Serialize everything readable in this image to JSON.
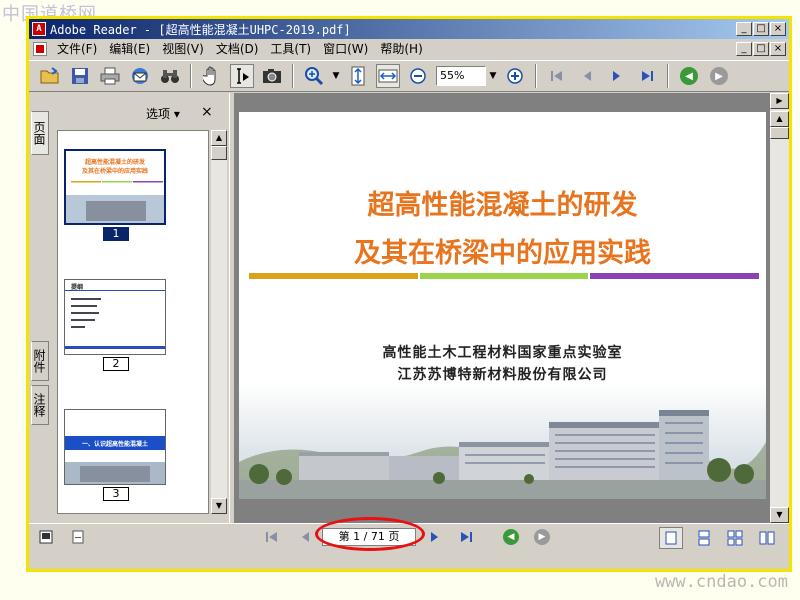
{
  "watermarks": {
    "top_left": "中国道桥网",
    "bottom_right": "www.cndao.com"
  },
  "window": {
    "title": "Adobe Reader - [超高性能混凝土UHPC-2019.pdf]",
    "logo": "adobe-reader-logo",
    "controls": {
      "minimize": "_",
      "maximize": "□",
      "close": "×"
    }
  },
  "menu": {
    "items": [
      {
        "label": "文件(F)",
        "name": "menu-file"
      },
      {
        "label": "编辑(E)",
        "name": "menu-edit"
      },
      {
        "label": "视图(V)",
        "name": "menu-view"
      },
      {
        "label": "文档(D)",
        "name": "menu-document"
      },
      {
        "label": "工具(T)",
        "name": "menu-tools"
      },
      {
        "label": "窗口(W)",
        "name": "menu-window"
      },
      {
        "label": "帮助(H)",
        "name": "menu-help"
      }
    ]
  },
  "toolbar": {
    "zoom_value": "55%",
    "icons": {
      "open": "open-folder-icon",
      "save": "save-icon",
      "print": "print-icon",
      "email": "email-icon",
      "search": "binoculars-icon",
      "hand": "hand-tool-icon",
      "select": "select-text-icon",
      "snapshot": "snapshot-camera-icon",
      "zoom_in": "zoom-in-icon",
      "fit_height": "fit-height-icon",
      "fit_width": "fit-width-icon",
      "zoom_out_minus": "zoom-out-minus-icon",
      "zoom_in_plus": "zoom-in-plus-icon",
      "first": "first-page-icon",
      "prev": "previous-page-icon",
      "next": "next-page-icon",
      "last": "last-page-icon",
      "back": "go-back-icon",
      "forward": "go-forward-icon"
    }
  },
  "side_tabs": {
    "pages": "页面",
    "attachments": "附件",
    "comments": "注释"
  },
  "panel": {
    "options_label": "选项",
    "close_label": "×",
    "thumbnails": [
      {
        "label": "1",
        "selected": true,
        "title_line1": "超高性能混凝土的研发",
        "title_line2": "及其在桥梁中的应用实践"
      },
      {
        "label": "2",
        "selected": false,
        "heading": "提纲"
      },
      {
        "label": "3",
        "selected": false,
        "heading": "一、认识超高性能混凝土"
      }
    ]
  },
  "slide": {
    "title_line1": "超高性能混凝土的研发",
    "title_line2": "及其在桥梁中的应用实践",
    "org_line1": "高性能土木工程材料国家重点实验室",
    "org_line2": "江苏苏博特新材料股份有限公司",
    "accent_colors": [
      "#d9a31a",
      "#9bd44a",
      "#8a44b8"
    ]
  },
  "statusbar": {
    "page_indicator": "第 1 / 71 页"
  }
}
